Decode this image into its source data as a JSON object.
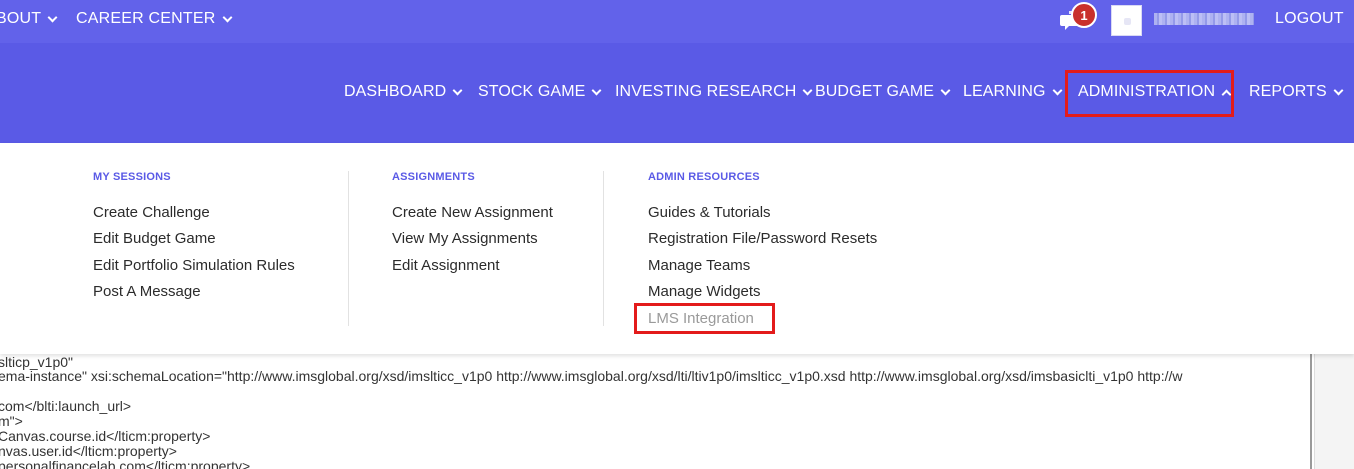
{
  "topbar": {
    "items": [
      {
        "label": "BOUT"
      },
      {
        "label": "CAREER CENTER"
      }
    ],
    "notification_count": "1",
    "logout_label": "LOGOUT",
    "icons": {
      "chat": "chat-bubbles-icon",
      "avatar": "user-avatar"
    }
  },
  "mainnav": {
    "items": [
      {
        "label": "DASHBOARD"
      },
      {
        "label": "STOCK GAME"
      },
      {
        "label": "INVESTING RESEARCH"
      },
      {
        "label": "BUDGET GAME"
      },
      {
        "label": "LEARNING"
      },
      {
        "label": "ADMINISTRATION"
      },
      {
        "label": "REPORTS"
      }
    ]
  },
  "dropdown": {
    "columns": [
      {
        "title": "MY SESSIONS",
        "links": [
          "Create Challenge",
          "Edit Budget Game",
          "Edit Portfolio Simulation Rules",
          "Post A Message"
        ]
      },
      {
        "title": "ASSIGNMENTS",
        "links": [
          "Create New Assignment",
          "View My Assignments",
          "Edit Assignment"
        ]
      },
      {
        "title": "ADMIN RESOURCES",
        "links": [
          "Guides & Tutorials",
          "Registration File/Password Resets",
          "Manage Teams",
          "Manage Widgets",
          "LMS Integration"
        ]
      }
    ]
  },
  "editor": {
    "lines": [
      "slticp_v1p0\"",
      "ema-instance\" xsi:schemaLocation=\"http://www.imsglobal.org/xsd/imslticc_v1p0 http://www.imsglobal.org/xsd/lti/ltiv1p0/imslticc_v1p0.xsd http://www.imsglobal.org/xsd/imsbasiclti_v1p0 http://w",
      "",
      "com</blti:launch_url>",
      "m\">",
      "Canvas.course.id</lticm:property>",
      "nvas.user.id</lticm:property>",
      "personalfinancelab.com</lticm:property>"
    ]
  },
  "colors": {
    "topbar_bg": "#6262ea",
    "nav_bg": "#5a5ae6",
    "highlight_red": "#e31b1b",
    "badge_red": "#c9302c"
  }
}
